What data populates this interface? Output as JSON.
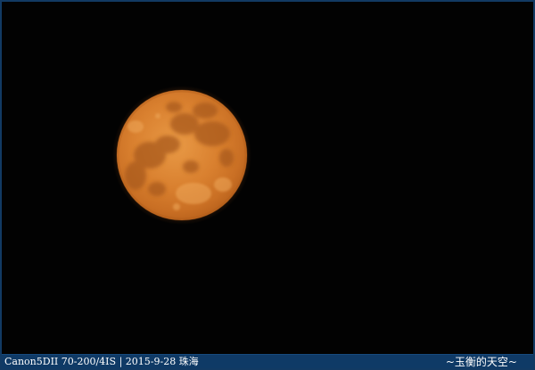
{
  "photo": {
    "subject": "moon-icon",
    "colors": {
      "sky": "#020202",
      "moon_light": "#e88f3a",
      "moon_mid": "#cf7428",
      "moon_dark": "#b2621f",
      "maria": "#a85c22"
    }
  },
  "caption": {
    "left": "Canon5DII 70-200/4IS | 2015-9-28 珠海",
    "right": "~玉衡的天空~"
  },
  "frame": {
    "border_color": "#123a63",
    "bar_color": "#0f3a66"
  }
}
